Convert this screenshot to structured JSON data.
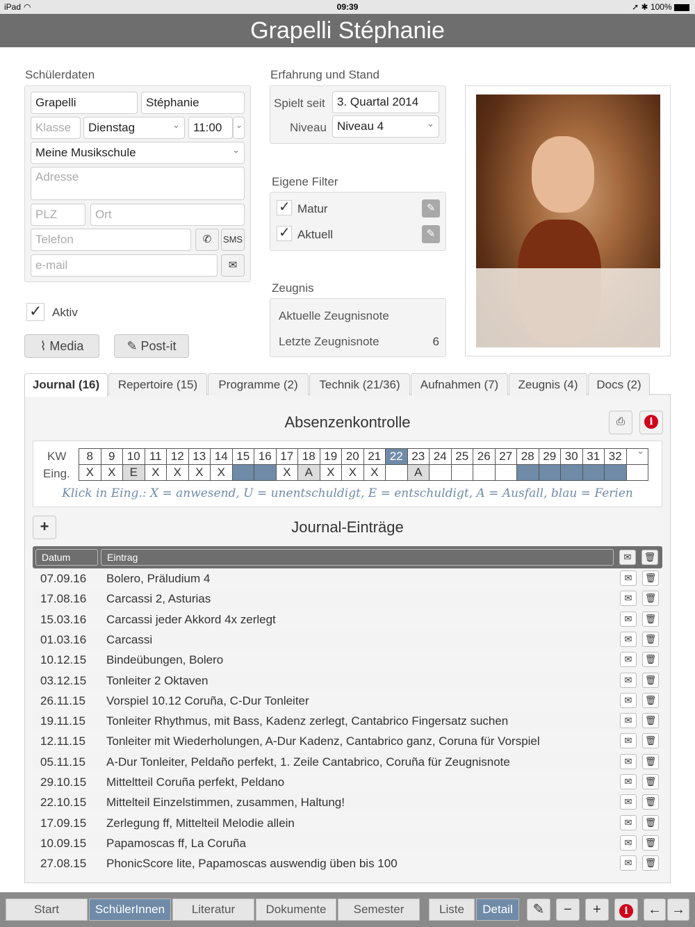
{
  "status": {
    "device": "iPad",
    "wifi_icon": "wifi-icon",
    "time": "09:39",
    "battery": "100%"
  },
  "title": "Grapelli Stéphanie",
  "student": {
    "section": "Schülerdaten",
    "last_name": "Grapelli",
    "first_name": "Stéphanie",
    "class_placeholder": "Klasse",
    "day": "Dienstag",
    "time": "11:00",
    "school": "Meine Musikschule",
    "address_placeholder": "Adresse",
    "zip_placeholder": "PLZ",
    "city_placeholder": "Ort",
    "phone_placeholder": "Telefon",
    "sms_label": "SMS",
    "email_placeholder": "e-mail",
    "active_label": "Aktiv"
  },
  "experience": {
    "section": "Erfahrung und Stand",
    "plays_since_label": "Spielt seit",
    "plays_since": "3. Quartal 2014",
    "level_label": "Niveau",
    "level": "Niveau 4"
  },
  "filters": {
    "section": "Eigene Filter",
    "items": [
      "Matur",
      "Aktuell"
    ]
  },
  "report": {
    "section": "Zeugnis",
    "current_label": "Aktuelle Zeugnisnote",
    "current_value": "",
    "last_label": "Letzte Zeugnisnote",
    "last_value": "6"
  },
  "buttons": {
    "media": "Media",
    "postit": "Post-it"
  },
  "tabs": [
    "Journal (16)",
    "Repertoire (15)",
    "Programme (2)",
    "Technik (21/36)",
    "Aufnahmen (7)",
    "Zeugnis (4)",
    "Docs (2)"
  ],
  "absence": {
    "title": "Absenzenkontrolle",
    "kw_label": "KW",
    "eing_label": "Eing.",
    "weeks": [
      "8",
      "9",
      "10",
      "11",
      "12",
      "13",
      "14",
      "15",
      "16",
      "17",
      "18",
      "19",
      "20",
      "21",
      "22",
      "23",
      "24",
      "25",
      "26",
      "27",
      "28",
      "29",
      "30",
      "31",
      "32",
      ""
    ],
    "marks": [
      "X",
      "X",
      "E",
      "X",
      "X",
      "X",
      "X",
      "",
      "",
      "X",
      "A",
      "X",
      "X",
      "X",
      "",
      "A",
      "",
      "",
      "",
      "",
      "",
      "",
      "",
      "",
      "",
      ""
    ],
    "holiday_weeks": [
      "15",
      "16",
      "28",
      "29",
      "30",
      "31",
      "32"
    ],
    "selected_week": "22",
    "legend": "Klick in Eing.: X = anwesend, U = unentschuldigt, E = entschuldigt, A = Ausfall, blau = Ferien"
  },
  "journal": {
    "title": "Journal-Einträge",
    "col_date": "Datum",
    "col_entry": "Eintrag",
    "entries": [
      {
        "date": "07.09.16",
        "text": "Bolero, Präludium 4"
      },
      {
        "date": "17.08.16",
        "text": "Carcassi 2, Asturias"
      },
      {
        "date": "15.03.16",
        "text": "Carcassi jeder Akkord 4x zerlegt"
      },
      {
        "date": "01.03.16",
        "text": "Carcassi"
      },
      {
        "date": "10.12.15",
        "text": "Bindeübungen, Bolero"
      },
      {
        "date": "03.12.15",
        "text": "Tonleiter 2 Oktaven"
      },
      {
        "date": "26.11.15",
        "text": "Vorspiel 10.12 Coruña, C-Dur Tonleiter"
      },
      {
        "date": "19.11.15",
        "text": "Tonleiter Rhythmus, mit Bass, Kadenz zerlegt, Cantabrico Fingersatz suchen"
      },
      {
        "date": "12.11.15",
        "text": "Tonleiter mit Wiederholungen, A-Dur Kadenz, Cantabrico ganz, Coruna für Vorspiel"
      },
      {
        "date": "05.11.15",
        "text": "A-Dur Tonleiter, Peldaño perfekt, 1. Zeile Cantabrico, Coruña für Zeugnisnote"
      },
      {
        "date": "29.10.15",
        "text": "Mitteltteil Coruña perfekt, Peldano"
      },
      {
        "date": "22.10.15",
        "text": "Mittelteil Einzelstimmen, zusammen, Haltung!"
      },
      {
        "date": "17.09.15",
        "text": "Zerlegung ff, Mittelteil Melodie allein"
      },
      {
        "date": "10.09.15",
        "text": "Papamoscas ff, La Coruña"
      },
      {
        "date": "27.08.15",
        "text": "PhonicScore lite, Papamoscas auswendig üben bis 100"
      }
    ]
  },
  "bottom": {
    "nav": [
      "Start",
      "SchülerInnen",
      "Literatur",
      "Dokumente",
      "Semester"
    ],
    "view": [
      "Liste",
      "Detail"
    ]
  },
  "colors": {
    "accent": "#6f8ba8",
    "titlebar": "#6e6e6e",
    "danger": "#d0021b"
  }
}
